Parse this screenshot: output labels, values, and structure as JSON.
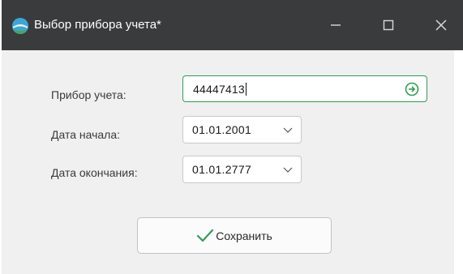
{
  "window": {
    "title": "Выбор прибора учета*",
    "icon": "globe-icon",
    "controls": {
      "minimize_icon": "minimize-icon",
      "maximize_icon": "maximize-icon",
      "close_icon": "close-icon"
    }
  },
  "form": {
    "device": {
      "label": "Прибор учета:",
      "value": "44447413",
      "action_icon": "arrow-right-circle-icon"
    },
    "start_date": {
      "label": "Дата начала:",
      "value": "01.01.2001",
      "dropdown_icon": "chevron-down-icon"
    },
    "end_date": {
      "label": "Дата окончания:",
      "value": "01.01.2777",
      "dropdown_icon": "chevron-down-icon"
    }
  },
  "actions": {
    "save_label": "Сохранить",
    "save_icon": "checkmark-icon"
  },
  "colors": {
    "titlebar": "#3a3b3d",
    "body": "#f0f0f0",
    "accent_green": "#2e9e55"
  }
}
